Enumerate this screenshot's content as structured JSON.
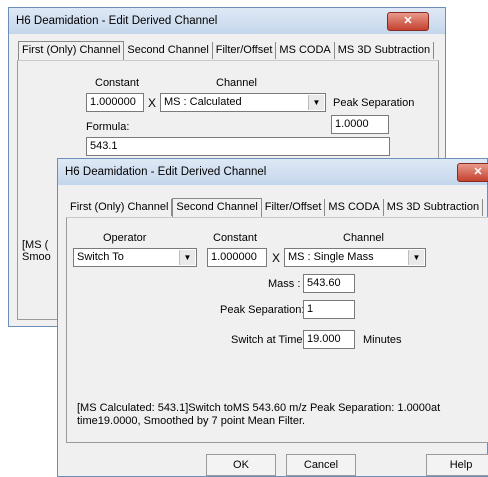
{
  "back_dialog": {
    "title": "H6 Deamidation - Edit Derived Channel",
    "close_glyph": "✕",
    "tabs": [
      "First (Only) Channel",
      "Second Channel",
      "Filter/Offset",
      "MS CODA",
      "MS 3D Subtraction"
    ],
    "active_tab": 0,
    "constant_label": "Constant",
    "constant_value": "1.000000",
    "times_sign": "X",
    "channel_label": "Channel",
    "channel_value": "MS : Calculated",
    "peak_separation_label": "Peak Separation",
    "peak_separation_value": "1.0000",
    "formula_label": "Formula:",
    "formula_value": "543.1",
    "summary_fragment": "[MS (\nSmoo"
  },
  "front_dialog": {
    "title": "H6 Deamidation - Edit Derived Channel",
    "tabs": [
      "First (Only) Channel",
      "Second Channel",
      "Filter/Offset",
      "MS CODA",
      "MS 3D Subtraction"
    ],
    "active_tab": 1,
    "operator_label": "Operator",
    "operator_value": "Switch To",
    "constant_label": "Constant",
    "constant_value": "1.000000",
    "times_sign": "X",
    "channel_label": "Channel",
    "channel_value": "MS : Single Mass",
    "mass_label": "Mass :",
    "mass_value": "543.60",
    "peak_separation_label": "Peak Separation:",
    "peak_separation_value": "1",
    "switch_time_label": "Switch at Time",
    "switch_time_value": "19.000",
    "minutes_label": "Minutes",
    "summary_text": "[MS Calculated: 543.1]Switch toMS 543.60 m/z Peak Separation: 1.0000at time19.0000, Smoothed by 7 point Mean Filter.",
    "ok_label": "OK",
    "cancel_label": "Cancel",
    "help_label": "Help"
  },
  "icons": {
    "dropdown": "chevron-down-icon",
    "close": "close-icon"
  }
}
